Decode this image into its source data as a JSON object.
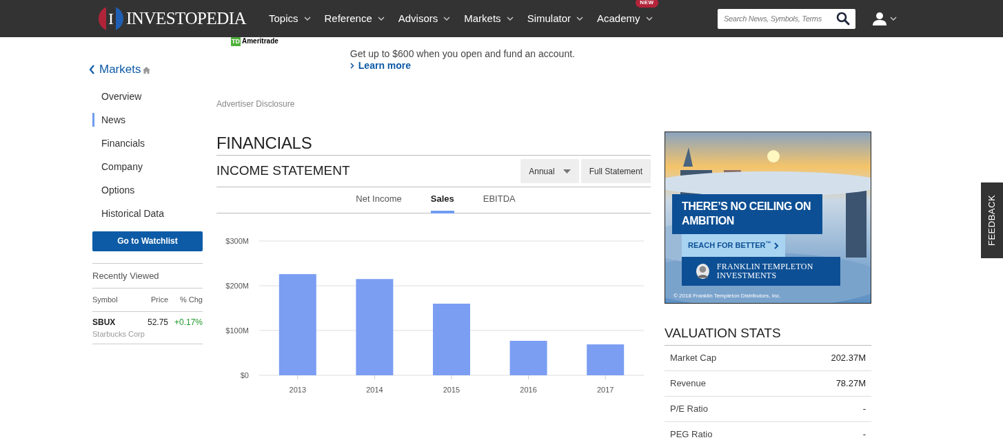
{
  "nav": {
    "logo_mark": "I",
    "logo": "INVESTOPEDIA",
    "items": [
      {
        "label": "Topics"
      },
      {
        "label": "Reference"
      },
      {
        "label": "Advisors"
      },
      {
        "label": "Markets"
      },
      {
        "label": "Simulator"
      },
      {
        "label": "Academy",
        "badge": "NEW"
      }
    ],
    "search": {
      "placeholder": "Search News, Symbols, Terms"
    }
  },
  "top_ad": {
    "brand_mark": "TD",
    "brand": "Ameritrade",
    "text": "Get up to $600 when you open and fund an account.",
    "link": "Learn more"
  },
  "sidebar": {
    "title": "Markets",
    "items": [
      {
        "label": "Overview",
        "selected": false
      },
      {
        "label": "News",
        "selected": true
      },
      {
        "label": "Financials",
        "selected": false
      },
      {
        "label": "Company",
        "selected": false
      },
      {
        "label": "Options",
        "selected": false
      },
      {
        "label": "Historical Data",
        "selected": false
      }
    ],
    "button": "Go to Watchlist",
    "recent": {
      "title": "Recently Viewed",
      "columns": [
        "Symbol",
        "Price",
        "% Chg"
      ],
      "rows": [
        {
          "symbol": "SBUX",
          "name": "Starbucks Corp",
          "price": "52.75",
          "change": "+0.17%"
        }
      ]
    }
  },
  "advertiser_disclosure": "Advertiser Disclosure",
  "financials": {
    "title": "FINANCIALS",
    "section": "INCOME STATEMENT",
    "period": "Annual",
    "full_statement": "Full Statement",
    "tabs": [
      {
        "label": "Net Income",
        "selected": false
      },
      {
        "label": "Sales",
        "selected": true
      },
      {
        "label": "EBITDA",
        "selected": false
      }
    ],
    "chart_data": {
      "type": "bar",
      "categories": [
        "2013",
        "2014",
        "2015",
        "2016",
        "2017"
      ],
      "values": [
        226,
        215,
        160,
        77,
        69
      ],
      "ylim": [
        0,
        300
      ],
      "yticks": [
        {
          "value": 0,
          "label": "$0"
        },
        {
          "value": 100,
          "label": "$100M"
        },
        {
          "value": 200,
          "label": "$200M"
        },
        {
          "value": 300,
          "label": "$300M"
        }
      ]
    }
  },
  "side_ad": {
    "headline": "THERE’S NO CEILING ON AMBITION",
    "cta": "REACH FOR BETTER$^{™}$",
    "brand": "FRANKLIN TEMPLETON INVESTMENTS",
    "copyright": "© 2018 Franklin Templeton Distributors, Inc."
  },
  "valuation": {
    "title": "VALUATION STATS",
    "rows": [
      {
        "label": "Market Cap",
        "value": "202.37M"
      },
      {
        "label": "Revenue",
        "value": "78.27M"
      },
      {
        "label": "P/E Ratio",
        "value": "-"
      },
      {
        "label": "PEG Ratio",
        "value": "-"
      }
    ]
  },
  "feedback": "FEEDBACK"
}
